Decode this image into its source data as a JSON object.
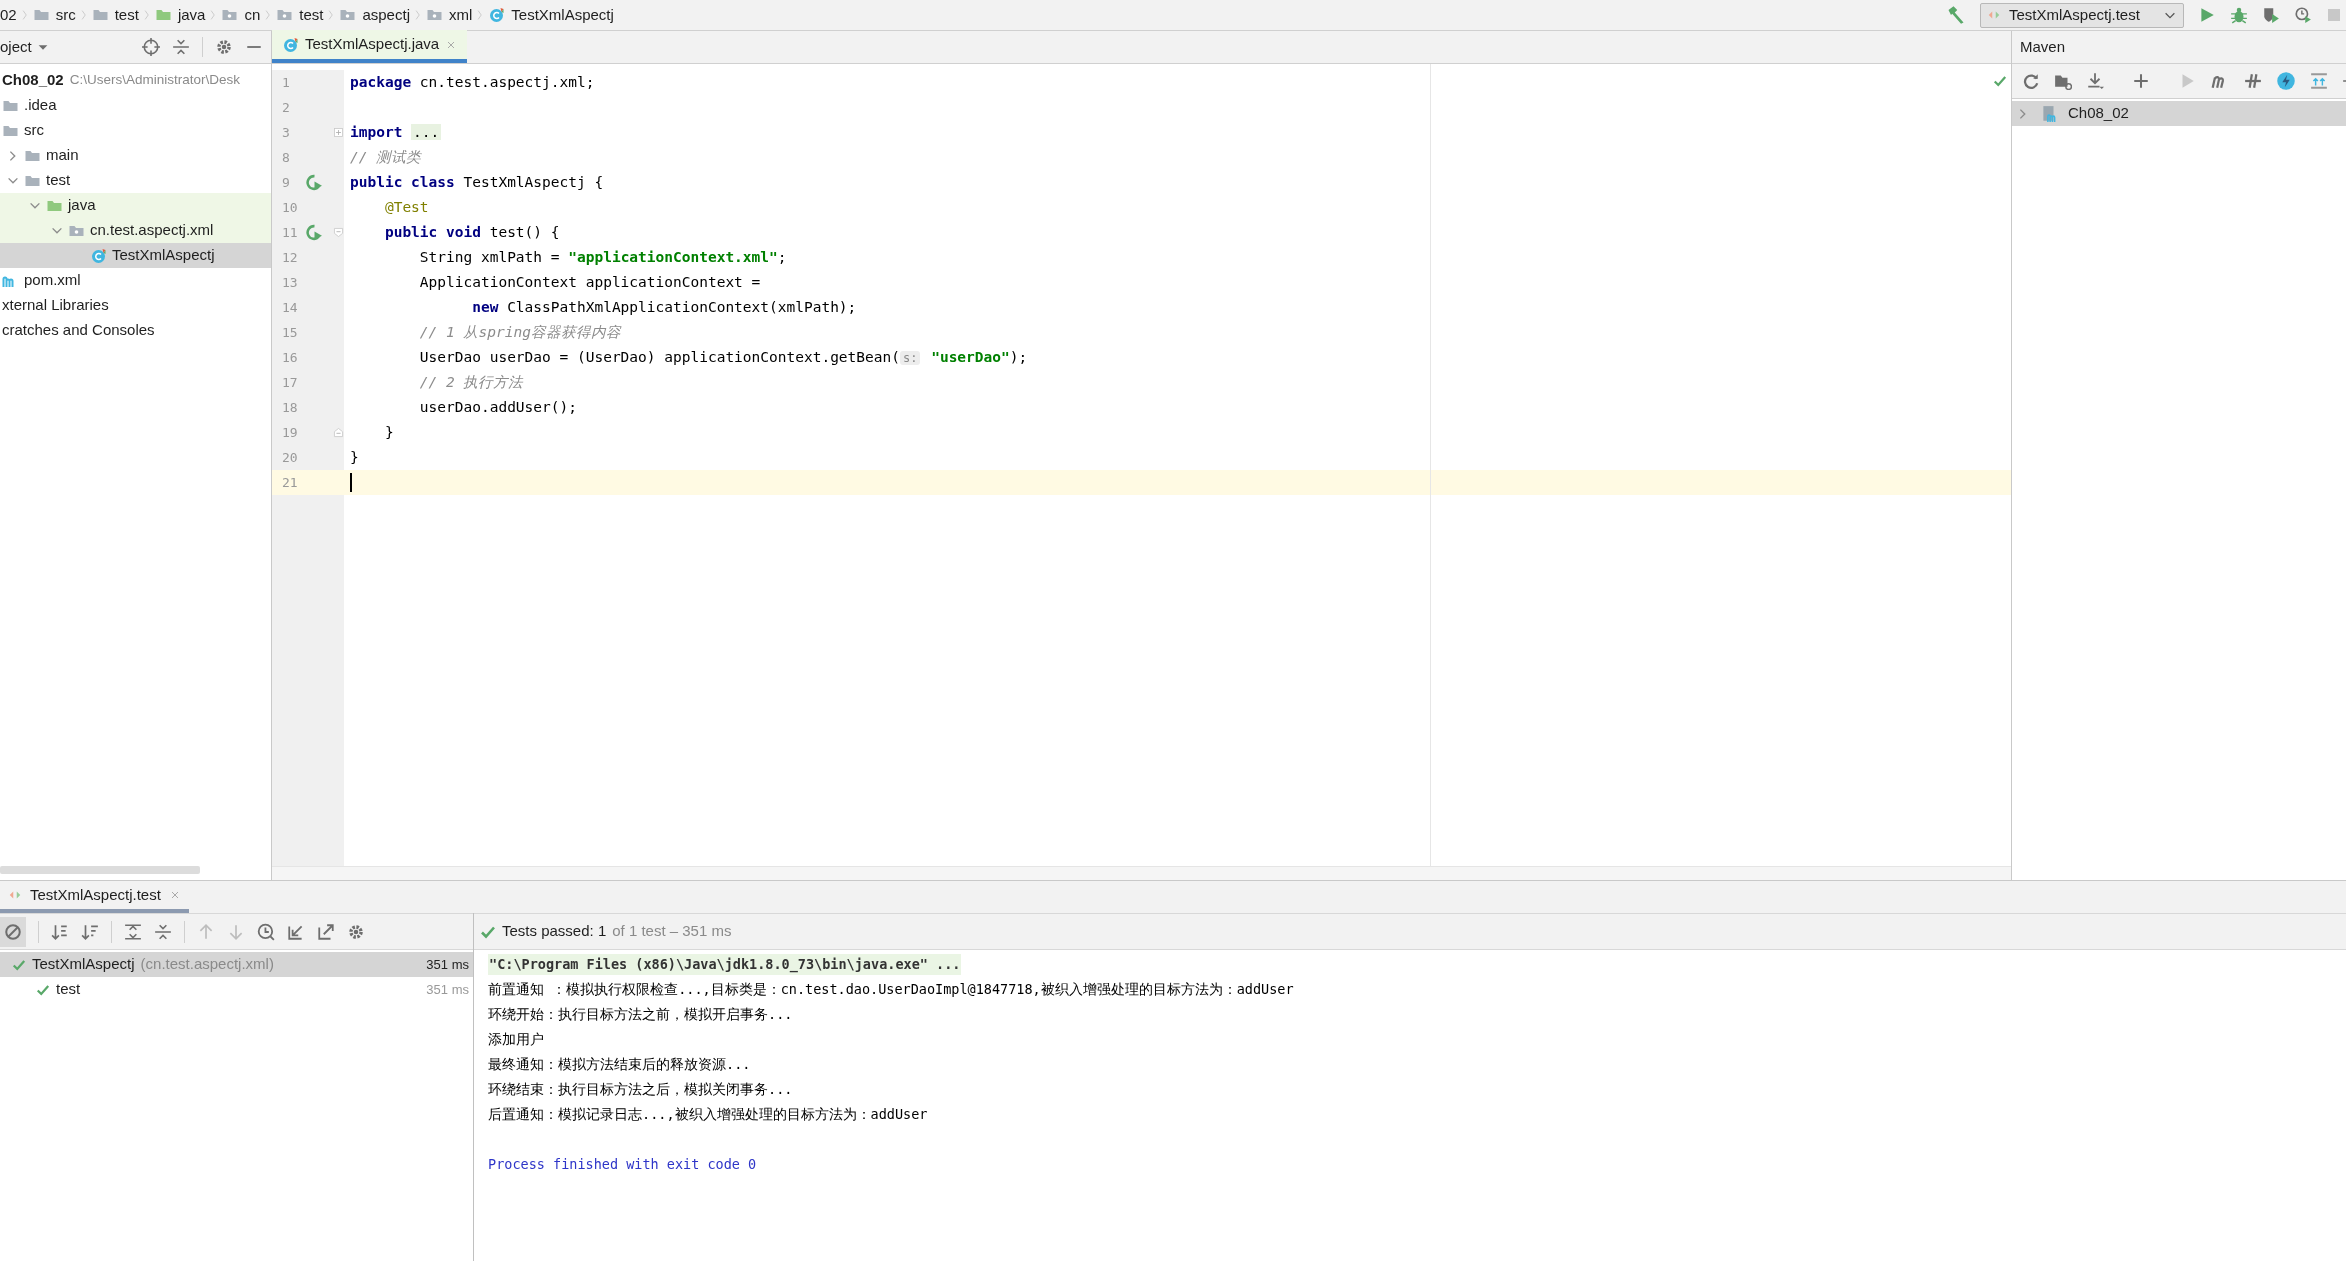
{
  "breadcrumb": [
    {
      "label": "02"
    },
    {
      "label": "src",
      "kind": "folder"
    },
    {
      "label": "test",
      "kind": "folder"
    },
    {
      "label": "java",
      "kind": "source-folder"
    },
    {
      "label": "cn",
      "kind": "package"
    },
    {
      "label": "test",
      "kind": "package"
    },
    {
      "label": "aspectj",
      "kind": "package"
    },
    {
      "label": "xml",
      "kind": "package"
    },
    {
      "label": "TestXmlAspectj",
      "kind": "class"
    }
  ],
  "run_configuration": {
    "label": "TestXmlAspectj.test"
  },
  "project_panel": {
    "title": "oject"
  },
  "project_tree": [
    {
      "label": "Ch08_02",
      "bold": true,
      "path": "C:\\Users\\Administrator\\Desk",
      "selected": false,
      "children": [
        {
          "label": ".idea",
          "kind": "folder",
          "selected": false
        },
        {
          "label": "src",
          "kind": "folder",
          "selected": false,
          "children": [
            {
              "label": "main",
              "kind": "folder",
              "expanded": false,
              "selected": false
            },
            {
              "label": "test",
              "kind": "folder",
              "expanded": true,
              "selected": false,
              "children": [
                {
                  "label": "java",
                  "kind": "source-folder",
                  "expanded": true,
                  "highlighted": true,
                  "selected": false,
                  "children": [
                    {
                      "label": "cn.test.aspectj.xml",
                      "kind": "package",
                      "expanded": true,
                      "highlighted": true,
                      "selected": false,
                      "children": [
                        {
                          "label": "TestXmlAspectj",
                          "kind": "class",
                          "selected": true
                        }
                      ]
                    }
                  ]
                }
              ]
            }
          ]
        },
        {
          "label": "pom.xml",
          "kind": "maven",
          "selected": false
        }
      ]
    },
    {
      "label": "xternal Libraries",
      "selected": false
    },
    {
      "label": "cratches and Consoles",
      "selected": false
    }
  ],
  "editor_tabs": [
    {
      "label": "TestXmlAspectj.java",
      "kind": "class",
      "selected": true
    }
  ],
  "code_lines": [
    {
      "number": "1",
      "kind": "plain",
      "current": false,
      "run_icon": false,
      "tokens": [
        {
          "kind": "keyword",
          "text": "package"
        },
        {
          "kind": "plain",
          "text": " cn.test.aspectj.xml;"
        }
      ]
    },
    {
      "number": "2",
      "kind": "plain",
      "current": false,
      "run_icon": false
    },
    {
      "number": "3",
      "kind": "fold-collapsed",
      "current": false,
      "run_icon": false,
      "tokens": [
        {
          "kind": "keyword",
          "text": "import "
        },
        {
          "kind": "folded",
          "text": "..."
        }
      ]
    },
    {
      "number": "8",
      "kind": "plain",
      "current": false,
      "run_icon": false,
      "tokens": [
        {
          "kind": "comment",
          "text": "// 测试类"
        }
      ]
    },
    {
      "number": "9",
      "kind": "plain",
      "current": false,
      "run_icon": true,
      "tokens": [
        {
          "kind": "keyword",
          "text": "public class"
        },
        {
          "kind": "plain",
          "text": " TestXmlAspectj {"
        }
      ]
    },
    {
      "number": "10",
      "kind": "plain",
      "current": false,
      "run_icon": false,
      "tokens": [
        {
          "kind": "annotation",
          "text": "    @Test"
        }
      ]
    },
    {
      "number": "11",
      "kind": "fold-start",
      "current": false,
      "run_icon": true,
      "tokens": [
        {
          "kind": "keyword",
          "text": "    public void"
        },
        {
          "kind": "plain",
          "text": " test() {"
        }
      ]
    },
    {
      "number": "12",
      "kind": "plain",
      "current": false,
      "run_icon": false,
      "tokens": [
        {
          "kind": "plain",
          "text": "        String xmlPath = "
        },
        {
          "kind": "string",
          "text": "\"applicationContext.xml\""
        },
        {
          "kind": "plain",
          "text": ";"
        }
      ]
    },
    {
      "number": "13",
      "kind": "plain",
      "current": false,
      "run_icon": false,
      "tokens": [
        {
          "kind": "plain",
          "text": "        ApplicationContext applicationContext ="
        }
      ]
    },
    {
      "number": "14",
      "kind": "plain",
      "current": false,
      "run_icon": false,
      "tokens": [
        {
          "kind": "keyword",
          "text": "              new"
        },
        {
          "kind": "plain",
          "text": " ClassPathXmlApplicationContext(xmlPath);"
        }
      ]
    },
    {
      "number": "15",
      "kind": "plain",
      "current": false,
      "run_icon": false,
      "tokens": [
        {
          "kind": "comment",
          "text": "        // 1 从spring容器获得内容"
        }
      ]
    },
    {
      "number": "16",
      "kind": "plain",
      "current": false,
      "run_icon": false,
      "tokens": [
        {
          "kind": "plain",
          "text": "        UserDao userDao = (UserDao) applicationContext.getBean("
        },
        {
          "kind": "hint",
          "text": "s:"
        },
        {
          "kind": "string",
          "text": " \"userDao\""
        },
        {
          "kind": "plain",
          "text": ");"
        }
      ]
    },
    {
      "number": "17",
      "kind": "plain",
      "current": false,
      "run_icon": false,
      "tokens": [
        {
          "kind": "comment",
          "text": "        // 2 执行方法"
        }
      ]
    },
    {
      "number": "18",
      "kind": "plain",
      "current": false,
      "run_icon": false,
      "tokens": [
        {
          "kind": "plain",
          "text": "        userDao.addUser();"
        }
      ]
    },
    {
      "number": "19",
      "kind": "fold-end",
      "current": false,
      "run_icon": false,
      "tokens": [
        {
          "kind": "plain",
          "text": "    }"
        }
      ]
    },
    {
      "number": "20",
      "kind": "plain",
      "current": false,
      "run_icon": false,
      "tokens": [
        {
          "kind": "plain",
          "text": "}"
        }
      ]
    },
    {
      "number": "21",
      "kind": "plain",
      "current": true,
      "run_icon": false
    }
  ],
  "maven_panel": {
    "title": "Maven",
    "tree": [
      {
        "label": "Ch08_02",
        "expanded": false,
        "selected": true
      }
    ]
  },
  "run_panel": {
    "tab": {
      "label": "TestXmlAspectj.test",
      "selected": true
    },
    "status": {
      "label": "Tests passed: 1",
      "detail": "of 1 test – 351 ms"
    },
    "tests": [
      {
        "label": "TestXmlAspectj",
        "detail": "(cn.test.aspectj.xml)",
        "time": "351 ms",
        "passed": true,
        "selected": true,
        "children": [
          {
            "label": "test",
            "time": "351 ms",
            "passed": true,
            "selected": false
          }
        ]
      }
    ],
    "console": [
      {
        "kind": "command",
        "text": "\"C:\\Program Files (x86)\\Java\\jdk1.8.0_73\\bin\\java.exe\" ..."
      },
      {
        "kind": "output",
        "text": "前置通知 ：模拟执行权限检查...,目标类是：cn.test.dao.UserDaoImpl@1847718,被织入增强处理的目标方法为：addUser"
      },
      {
        "kind": "output",
        "text": "环绕开始：执行目标方法之前，模拟开启事务..."
      },
      {
        "kind": "output",
        "text": "添加用户"
      },
      {
        "kind": "output",
        "text": "最终通知：模拟方法结束后的释放资源..."
      },
      {
        "kind": "output",
        "text": "环绕结束：执行目标方法之后，模拟关闭事务..."
      },
      {
        "kind": "output",
        "text": "后置通知：模拟记录日志...,被织入增强处理的目标方法为：addUser"
      },
      {
        "kind": "blank"
      },
      {
        "kind": "exit",
        "text": "Process finished with exit code 0"
      }
    ]
  }
}
